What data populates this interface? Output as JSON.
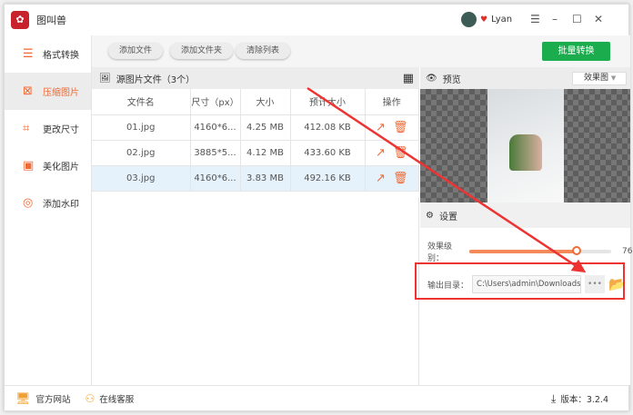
{
  "app": {
    "name": "图叫兽",
    "user": "Lyan"
  },
  "sidebar": {
    "items": [
      {
        "label": "格式转换",
        "icon": "format-icon"
      },
      {
        "label": "压缩图片",
        "icon": "compress-icon",
        "active": true
      },
      {
        "label": "更改尺寸",
        "icon": "resize-icon"
      },
      {
        "label": "美化图片",
        "icon": "beautify-icon"
      },
      {
        "label": "添加水印",
        "icon": "watermark-icon"
      }
    ]
  },
  "toolbar": {
    "add_file": "添加文件",
    "add_folder": "添加文件夹",
    "clear_list": "清除列表",
    "batch": "批量转换"
  },
  "list": {
    "title": "源图片文件（3个）",
    "columns": [
      "文件名",
      "尺寸（px）",
      "大小",
      "预计大小",
      "操作"
    ],
    "rows": [
      {
        "name": "01.jpg",
        "dims": "4160*6...",
        "size": "4.25 MB",
        "est": "412.08 KB"
      },
      {
        "name": "02.jpg",
        "dims": "3885*5...",
        "size": "4.12 MB",
        "est": "433.60 KB"
      },
      {
        "name": "03.jpg",
        "dims": "4160*6...",
        "size": "3.83 MB",
        "est": "492.16 KB",
        "selected": true
      }
    ]
  },
  "preview": {
    "title": "预览",
    "mode": "效果图"
  },
  "settings": {
    "title": "设置",
    "quality_label": "效果级别：",
    "quality": 76,
    "output_label": "输出目录：",
    "output_path": "C:\\Users\\admin\\Downloads",
    "browse": "•••"
  },
  "footer": {
    "website": "官方网站",
    "support": "在线客服",
    "version": "版本：3.2.4"
  },
  "colors": {
    "accent": "#f06a35",
    "green": "#1aac4d",
    "annotation": "#e33333"
  }
}
